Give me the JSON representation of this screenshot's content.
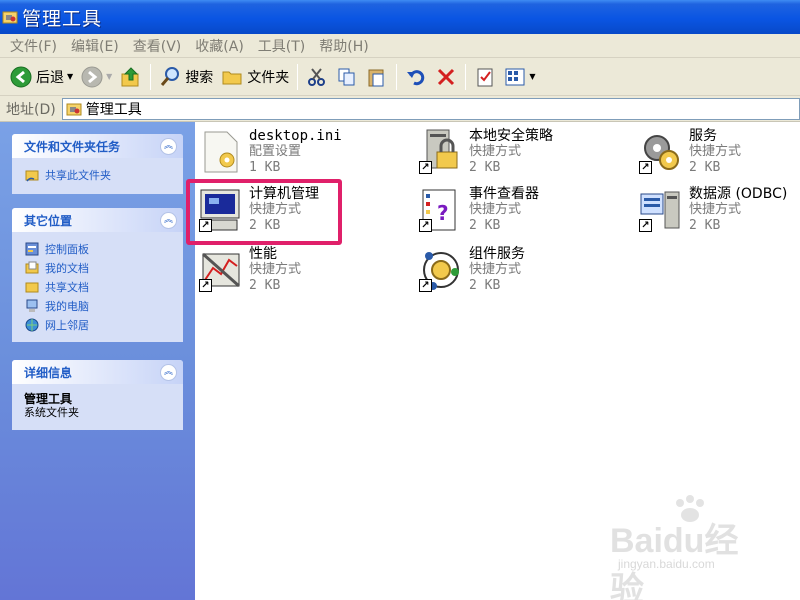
{
  "window": {
    "title": "管理工具"
  },
  "menu": [
    "文件(F)",
    "编辑(E)",
    "查看(V)",
    "收藏(A)",
    "工具(T)",
    "帮助(H)"
  ],
  "toolbar": {
    "back_label": "后退",
    "search_label": "搜索",
    "folders_label": "文件夹"
  },
  "address": {
    "label": "地址(D)",
    "value": "管理工具"
  },
  "left_panels": {
    "tasks": {
      "title": "文件和文件夹任务",
      "items": [
        {
          "label": "共享此文件夹",
          "icon": "share-folder-icon"
        }
      ]
    },
    "places": {
      "title": "其它位置",
      "items": [
        {
          "label": "控制面板",
          "icon": "control-panel-icon"
        },
        {
          "label": "我的文档",
          "icon": "my-documents-icon"
        },
        {
          "label": "共享文档",
          "icon": "shared-documents-icon"
        },
        {
          "label": "我的电脑",
          "icon": "my-computer-icon"
        },
        {
          "label": "网上邻居",
          "icon": "network-icon"
        }
      ]
    },
    "details": {
      "title": "详细信息",
      "name": "管理工具",
      "description": "系统文件夹"
    }
  },
  "files": [
    {
      "name": "desktop.ini",
      "type": "配置设置",
      "size": "1 KB",
      "icon": "config-file-icon"
    },
    {
      "name": "本地安全策略",
      "type": "快捷方式",
      "size": "2 KB",
      "icon": "security-policy-icon"
    },
    {
      "name": "服务",
      "type": "快捷方式",
      "size": "2 KB",
      "icon": "services-icon"
    },
    {
      "name": "计算机管理",
      "type": "快捷方式",
      "size": "2 KB",
      "icon": "computer-management-icon"
    },
    {
      "name": "事件查看器",
      "type": "快捷方式",
      "size": "2 KB",
      "icon": "event-viewer-icon"
    },
    {
      "name": "数据源 (ODBC)",
      "type": "快捷方式",
      "size": "2 KB",
      "icon": "odbc-icon"
    },
    {
      "name": "性能",
      "type": "快捷方式",
      "size": "2 KB",
      "icon": "performance-icon"
    },
    {
      "name": "组件服务",
      "type": "快捷方式",
      "size": "2 KB",
      "icon": "component-services-icon"
    }
  ],
  "watermark": {
    "text": "Baidu经验",
    "sub": "jingyan.baidu.com"
  },
  "colors": {
    "titlebar": "#0a55e3",
    "highlight": "#e0206a",
    "panel_link": "#215dc6"
  }
}
